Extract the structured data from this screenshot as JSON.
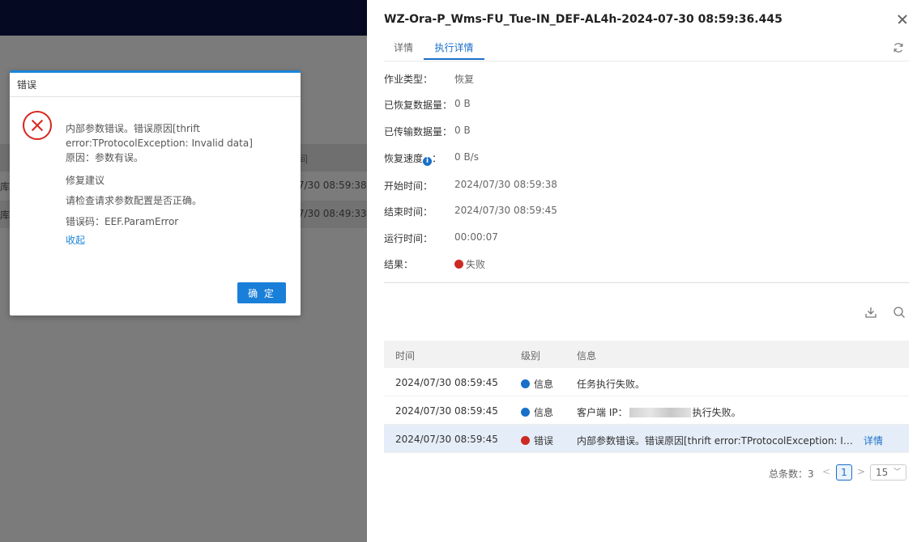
{
  "background": {
    "header_cell": "间",
    "rows": [
      {
        "left": "库",
        "time": "7/30 08:59:38"
      },
      {
        "left": "库",
        "time": "7/30 08:49:33"
      }
    ]
  },
  "modal": {
    "title": "错误",
    "line1": "内部参数错误。错误原因[thrift",
    "line2": "error:TProtocolException: Invalid data]",
    "line3": "原因：参数有误。",
    "suggestion_title": "修复建议",
    "suggestion": "请检查请求参数配置是否正确。",
    "error_code": "错误码：EEF.ParamError",
    "collapse": "收起",
    "ok": "确 定"
  },
  "drawer": {
    "title": "WZ-Ora-P_Wms-FU_Tue-IN_DEF-AL4h-2024-07-30 08:59:36.445",
    "tabs": [
      "详情",
      "执行详情"
    ],
    "fields": [
      {
        "label": "作业类型：",
        "value": "恢复"
      },
      {
        "label": "已恢复数据量：",
        "value": "0 B"
      },
      {
        "label": "已传输数据量：",
        "value": "0 B"
      },
      {
        "label": "恢复速度",
        "suffix": "：",
        "value": "0 B/s"
      },
      {
        "label": "开始时间：",
        "value": "2024/07/30 08:59:38"
      },
      {
        "label": "结束时间：",
        "value": "2024/07/30 08:59:45"
      },
      {
        "label": "运行时间：",
        "value": "00:00:07"
      },
      {
        "label": "结果：",
        "value": "失败"
      }
    ],
    "log": {
      "headers": [
        "时间",
        "级别",
        "信息"
      ],
      "rows": [
        {
          "time": "2024/07/30 08:59:45",
          "level": "信息",
          "info": "任务执行失败。"
        },
        {
          "time": "2024/07/30 08:59:45",
          "level": "信息",
          "info_prefix": "客户端 IP：",
          "info_suffix": "执行失败。"
        },
        {
          "time": "2024/07/30 08:59:45",
          "level": "错误",
          "info": "内部参数错误。错误原因[thrift error:TProtocolException: I…",
          "action": "详情"
        }
      ]
    },
    "pager": {
      "total": "总条数：3",
      "prev": "<",
      "page": "1",
      "next": ">",
      "size": "15"
    }
  },
  "colors": {
    "accent": "#1a6fc9",
    "error": "#cc2a22",
    "topbar": "#050a22"
  }
}
